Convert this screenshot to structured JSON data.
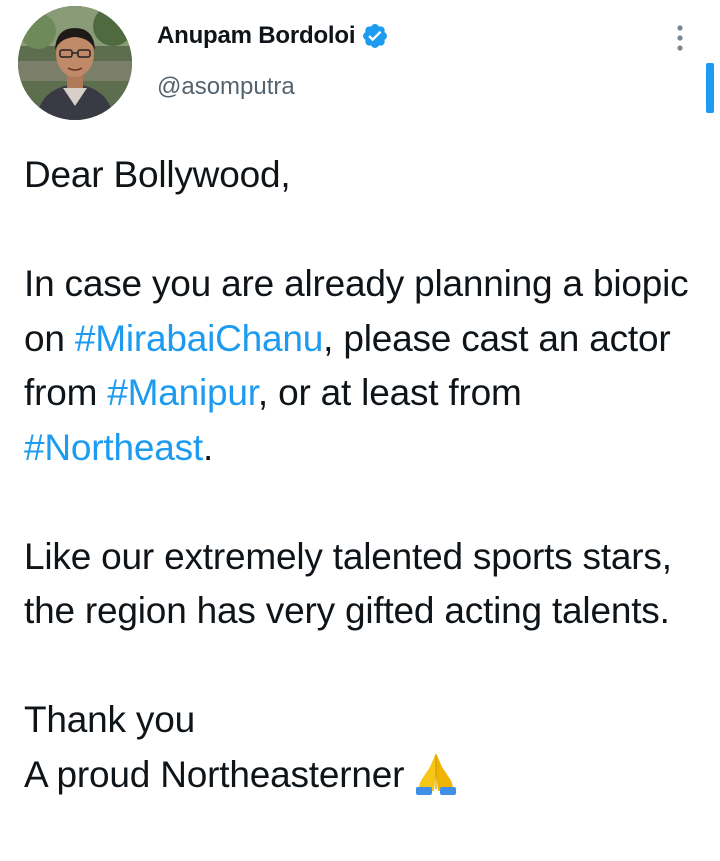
{
  "author": {
    "display_name": "Anupam Bordoloi",
    "handle": "@asomputra",
    "verified": true,
    "avatar_icon": "profile-photo",
    "verified_icon": "verified-badge-icon"
  },
  "menu": {
    "icon": "more-options-icon"
  },
  "tweet": {
    "line_salutation": "Dear Bollywood,",
    "p2_part1": "In case you are already planning a biopic on ",
    "hashtag_1": "#MirabaiChanu",
    "p2_part2": ", please cast an actor from ",
    "hashtag_2": "#Manipur",
    "p2_part3": ", or at least from ",
    "hashtag_3": "#Northeast",
    "p2_part4": ".",
    "p3": "Like our extremely talented sports stars, the region has very gifted acting talents.",
    "closing_line1": "Thank you",
    "closing_line2": "A proud Northeasterner",
    "emoji_icon": "folded-hands-icon"
  },
  "colors": {
    "accent": "#1d9bf0",
    "text": "#0f1419",
    "secondary_text": "#536471"
  }
}
